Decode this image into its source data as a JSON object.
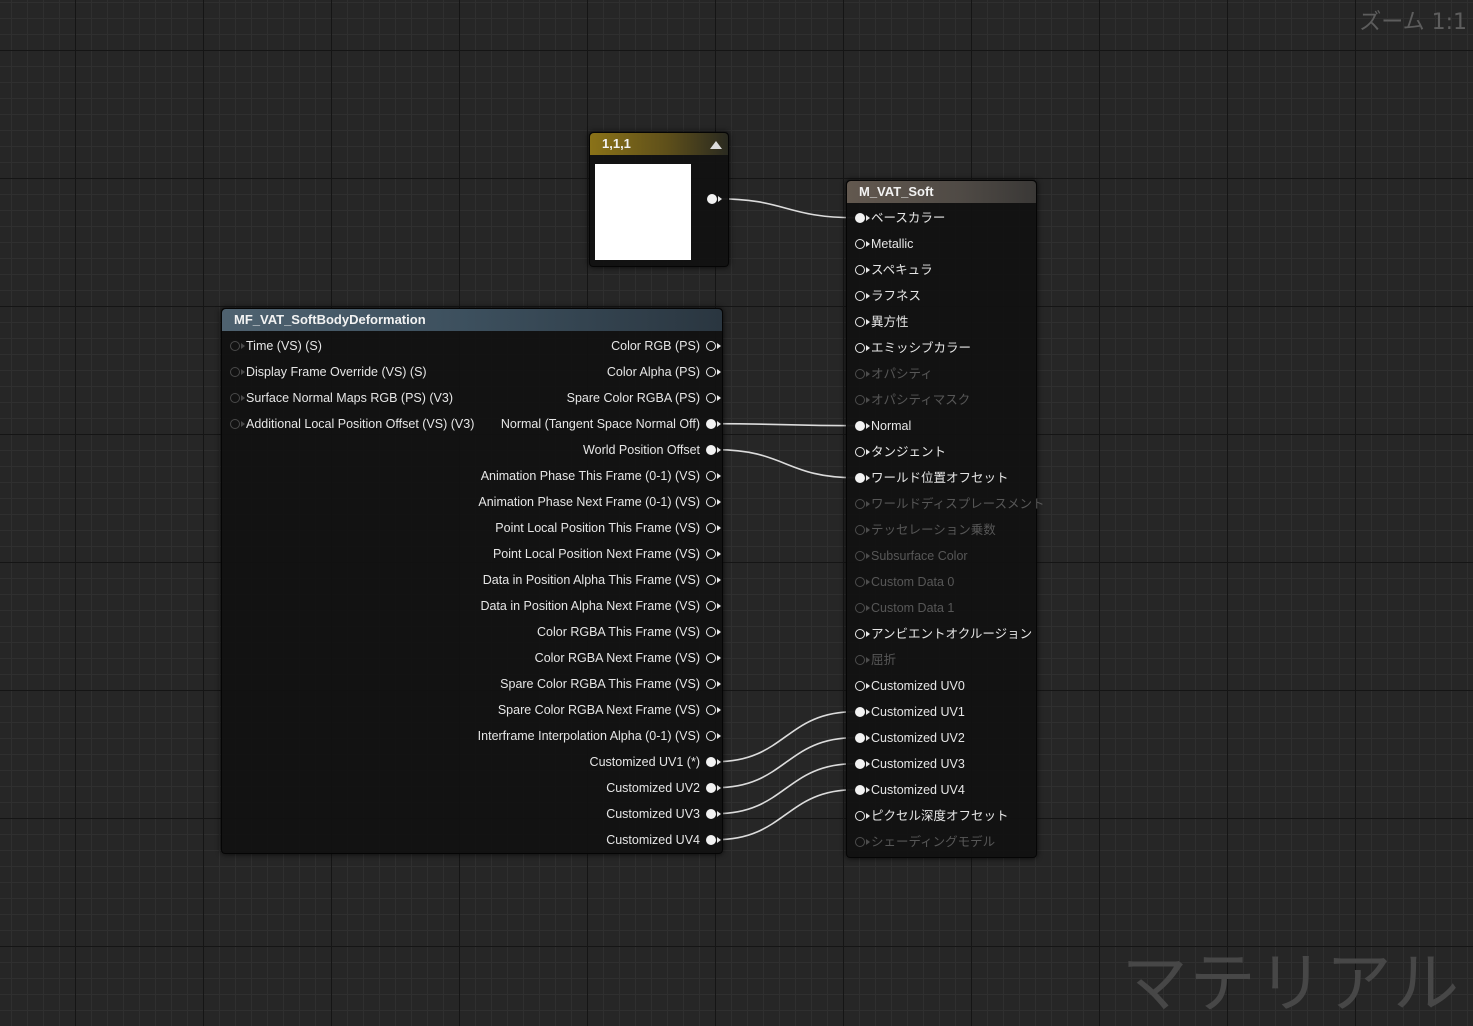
{
  "zoom_label": "ズーム 1:1",
  "watermark": "マテリアル",
  "constant_node": {
    "title": "1,1,1",
    "swatch_color": "#ffffff"
  },
  "function_node": {
    "title": "MF_VAT_SoftBodyDeformation",
    "inputs": [
      "Time (VS) (S)",
      "Display Frame Override (VS) (S)",
      "Surface Normal Maps RGB (PS) (V3)",
      "Additional Local Position Offset (VS) (V3)"
    ],
    "outputs": [
      {
        "label": "Color RGB (PS)",
        "connected": false
      },
      {
        "label": "Color Alpha (PS)",
        "connected": false
      },
      {
        "label": "Spare Color RGBA (PS)",
        "connected": false
      },
      {
        "label": "Normal (Tangent Space Normal Off)",
        "connected": true
      },
      {
        "label": "World Position Offset",
        "connected": true
      },
      {
        "label": "Animation Phase This Frame (0-1) (VS)",
        "connected": false
      },
      {
        "label": "Animation Phase Next Frame (0-1) (VS)",
        "connected": false
      },
      {
        "label": "Point Local Position This Frame (VS)",
        "connected": false
      },
      {
        "label": "Point Local Position Next Frame (VS)",
        "connected": false
      },
      {
        "label": "Data in Position Alpha This Frame (VS)",
        "connected": false
      },
      {
        "label": "Data in Position Alpha Next Frame (VS)",
        "connected": false
      },
      {
        "label": "Color RGBA This Frame (VS)",
        "connected": false
      },
      {
        "label": "Color RGBA Next Frame (VS)",
        "connected": false
      },
      {
        "label": "Spare Color RGBA This Frame (VS)",
        "connected": false
      },
      {
        "label": "Spare Color RGBA Next Frame (VS)",
        "connected": false
      },
      {
        "label": "Interframe Interpolation Alpha (0-1) (VS)",
        "connected": false
      },
      {
        "label": "Customized UV1 (*)",
        "connected": true
      },
      {
        "label": "Customized UV2",
        "connected": true
      },
      {
        "label": "Customized UV3",
        "connected": true
      },
      {
        "label": "Customized UV4",
        "connected": true
      }
    ]
  },
  "material_node": {
    "title": "M_VAT_Soft",
    "inputs": [
      {
        "label": "ベースカラー",
        "state": "connected"
      },
      {
        "label": "Metallic",
        "state": "enabled"
      },
      {
        "label": "スペキュラ",
        "state": "enabled"
      },
      {
        "label": "ラフネス",
        "state": "enabled"
      },
      {
        "label": "異方性",
        "state": "enabled"
      },
      {
        "label": "エミッシブカラー",
        "state": "enabled"
      },
      {
        "label": "オパシティ",
        "state": "disabled"
      },
      {
        "label": "オパシティマスク",
        "state": "disabled"
      },
      {
        "label": "Normal",
        "state": "connected"
      },
      {
        "label": "タンジェント",
        "state": "enabled"
      },
      {
        "label": "ワールド位置オフセット",
        "state": "connected"
      },
      {
        "label": "ワールドディスプレースメント",
        "state": "disabled"
      },
      {
        "label": "テッセレーション乗数",
        "state": "disabled"
      },
      {
        "label": "Subsurface Color",
        "state": "disabled"
      },
      {
        "label": "Custom Data 0",
        "state": "disabled"
      },
      {
        "label": "Custom Data 1",
        "state": "disabled"
      },
      {
        "label": "アンビエントオクルージョン",
        "state": "enabled"
      },
      {
        "label": "屈折",
        "state": "disabled"
      },
      {
        "label": "Customized UV0",
        "state": "enabled"
      },
      {
        "label": "Customized UV1",
        "state": "connected"
      },
      {
        "label": "Customized UV2",
        "state": "connected"
      },
      {
        "label": "Customized UV3",
        "state": "connected"
      },
      {
        "label": "Customized UV4",
        "state": "connected"
      },
      {
        "label": "ピクセル深度オフセット",
        "state": "enabled"
      },
      {
        "label": "シェーディングモデル",
        "state": "disabled"
      }
    ]
  }
}
